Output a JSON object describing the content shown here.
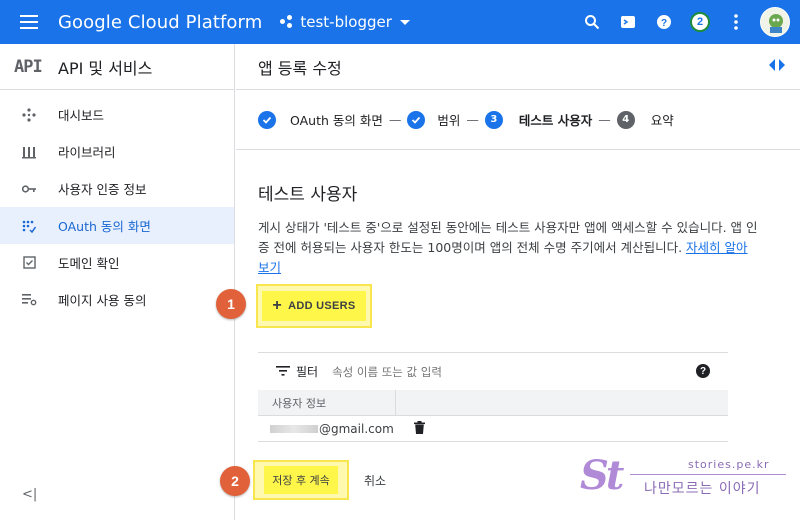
{
  "topbar": {
    "brand": "Google Cloud Platform",
    "project": "test-blogger",
    "notification_count": "2"
  },
  "sidebar": {
    "logo": "API",
    "title": "API 및 서비스",
    "items": [
      {
        "label": "대시보드",
        "icon": "dashboard-icon"
      },
      {
        "label": "라이브러리",
        "icon": "library-icon"
      },
      {
        "label": "사용자 인증 정보",
        "icon": "key-icon"
      },
      {
        "label": "OAuth 동의 화면",
        "icon": "oauth-icon",
        "active": true
      },
      {
        "label": "도메인 확인",
        "icon": "domain-check-icon"
      },
      {
        "label": "페이지 사용 동의",
        "icon": "settings-list-icon"
      }
    ],
    "collapse_label": "<|"
  },
  "main": {
    "page_title": "앱 등록 수정",
    "steps": [
      {
        "label": "OAuth 동의 화면",
        "state": "done"
      },
      {
        "label": "범위",
        "state": "done"
      },
      {
        "num": "3",
        "label": "테스트 사용자",
        "state": "current"
      },
      {
        "num": "4",
        "label": "요약",
        "state": "pending"
      }
    ],
    "step_separator": "—",
    "section_title": "테스트 사용자",
    "description": "게시 상태가 '테스트 중'으로 설정된 동안에는 테스트 사용자만 앱에 액세스할 수 있습니다. 앱 인증 전에 허용되는 사용자 한도는 100명이며 앱의 전체 수명 주기에서 계산됩니다. ",
    "learn_more": "자세히 알아보기",
    "add_users_label": "ADD USERS",
    "filter_label": "필터",
    "filter_placeholder": "속성 이름 또는 값 입력",
    "help_symbol": "?",
    "table": {
      "header": "사용자 정보",
      "rows": [
        {
          "email_suffix": "@gmail.com"
        }
      ]
    },
    "save_label": "저장 후 계속",
    "cancel_label": "취소"
  },
  "callouts": [
    "1",
    "2"
  ],
  "watermark": {
    "logo": "St",
    "url": "stories.pe.kr",
    "tagline": "나만모르는 이야기"
  },
  "colors": {
    "header_blue": "#1a73e8",
    "highlight_yellow": "#fff64a",
    "callout_orange": "#e0613a",
    "active_bg": "#e8f0fe"
  }
}
